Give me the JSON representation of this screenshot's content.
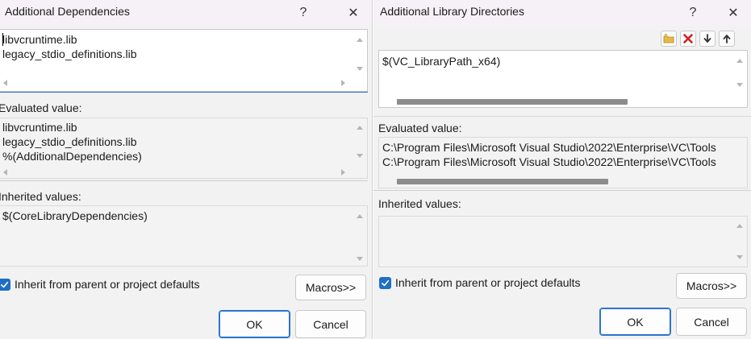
{
  "left": {
    "title": "Additional Dependencies",
    "help": "?",
    "close": "✕",
    "editor_lines": [
      "libvcruntime.lib",
      "legacy_stdio_definitions.lib"
    ],
    "evaluated_label": "Evaluated value:",
    "evaluated_lines": [
      "libvcruntime.lib",
      "legacy_stdio_definitions.lib",
      "%(AdditionalDependencies)"
    ],
    "inherited_label": "Inherited values:",
    "inherited_lines": [
      "$(CoreLibraryDependencies)"
    ],
    "inherit_checkbox_label": "Inherit from parent or project defaults",
    "inherit_checked": true,
    "macros_label": "Macros>>",
    "ok_label": "OK",
    "cancel_label": "Cancel"
  },
  "right": {
    "title": "Additional Library Directories",
    "help": "?",
    "close": "✕",
    "toolbar": {
      "icons": [
        "new-folder-icon",
        "delete-icon",
        "move-down-icon",
        "move-up-icon"
      ]
    },
    "editor_lines": [
      "$(VC_LibraryPath_x64)"
    ],
    "evaluated_label": "Evaluated value:",
    "evaluated_lines": [
      "C:\\Program Files\\Microsoft Visual Studio\\2022\\Enterprise\\VC\\Tools",
      "C:\\Program Files\\Microsoft Visual Studio\\2022\\Enterprise\\VC\\Tools"
    ],
    "inherited_label": "Inherited values:",
    "inherited_lines": [],
    "inherit_checkbox_label": "Inherit from parent or project defaults",
    "inherit_checked": true,
    "macros_label": "Macros>>",
    "ok_label": "OK",
    "cancel_label": "Cancel"
  },
  "colors": {
    "accent": "#1f6fc5",
    "titlebar": "#f6f1f6",
    "dialog_bg": "#f2f2f2"
  }
}
